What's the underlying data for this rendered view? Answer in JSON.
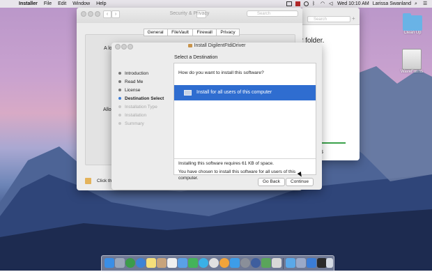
{
  "menubar": {
    "apple_icon": "apple-icon",
    "items": [
      "Installer",
      "File",
      "Edit",
      "Window",
      "Help"
    ],
    "clock": "Wed 10:10 AM",
    "user": "Larissa Swanland",
    "status_icons": [
      "display-icon",
      "red-app-icon",
      "time-machine-icon",
      "bluetooth-icon",
      "wifi-icon",
      "volume-icon",
      "search-icon",
      "list-icon"
    ]
  },
  "security_window": {
    "title": "Security & Privacy",
    "search_placeholder": "Search",
    "tabs": [
      "General",
      "FileVault",
      "Firewall",
      "Privacy"
    ],
    "fragment_top": "A lo",
    "fragment_allow": "Allo",
    "lock_text": "Click the"
  },
  "right_window": {
    "search_placeholder": "Search",
    "fragment_folder": "r folder.",
    "fragment_pts": "pts"
  },
  "installer": {
    "title": "Install DigilentFtdiDriver",
    "section_title": "Select a Destination",
    "steps": [
      {
        "label": "Introduction",
        "state": "done"
      },
      {
        "label": "Read Me",
        "state": "done"
      },
      {
        "label": "License",
        "state": "done"
      },
      {
        "label": "Destination Select",
        "state": "current"
      },
      {
        "label": "Installation Type",
        "state": "pending"
      },
      {
        "label": "Installation",
        "state": "pending"
      },
      {
        "label": "Summary",
        "state": "pending"
      }
    ],
    "question": "How do you want to install this software?",
    "option": "Install for all users of this computer",
    "space_required": "Installing this software requires 61 KB of space.",
    "chosen_text": "You have chosen to install this software for all users of this computer.",
    "go_back": "Go Back",
    "continue": "Continue"
  },
  "desktop_icons": [
    {
      "label": "Clean Up",
      "icon": "folder-icon"
    },
    {
      "label": "WaveForms",
      "icon": "disk-image-icon"
    }
  ],
  "dock_items": [
    "finder-icon",
    "launchpad-icon",
    "chrome-icon",
    "safari-icon",
    "notes-icon",
    "contacts-icon",
    "calendar-icon",
    "mail-icon",
    "facetime-icon",
    "messages-icon",
    "music-icon",
    "photos-icon",
    "app-store-icon",
    "preferences-icon",
    "installer-icon",
    "utility-icon",
    "terminal-icon",
    "folder-icon",
    "downloads-icon",
    "appstore-icon",
    "display-icon",
    "trash-icon"
  ]
}
